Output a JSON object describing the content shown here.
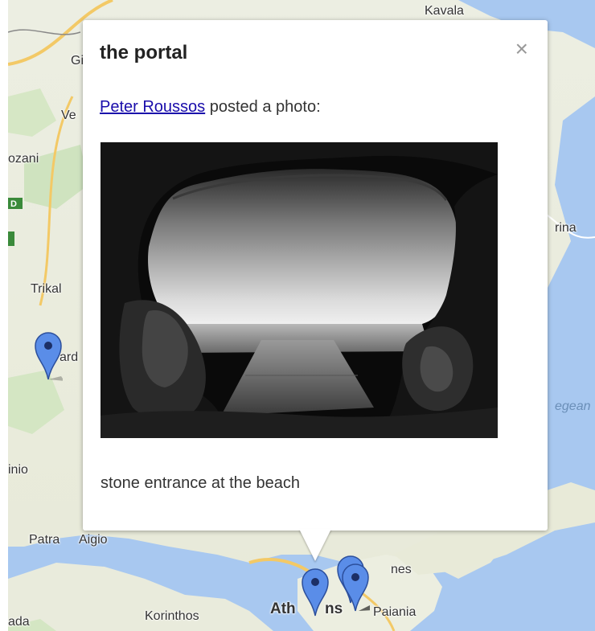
{
  "map": {
    "places": {
      "kavala": "Kavala",
      "gi": "Gi",
      "ve": "Ve",
      "kozani": "ozani",
      "trikala": "Trikal",
      "karditsa": "ard",
      "rina": "rina",
      "aegean": "egean",
      "agrinio": "inio",
      "patra": "Patra",
      "aigio": "Aigio",
      "chalkida": "nes",
      "athina": "Ath",
      "athina_b": "ns",
      "paiania": "Paiania",
      "korinthos": "Korinthos",
      "ada": "ada"
    },
    "highway_badge": "D"
  },
  "popup": {
    "title": "the portal",
    "close_label": "×",
    "author": "Peter Roussos",
    "posted_text": " posted a photo:",
    "caption": "stone entrance at the beach"
  },
  "colors": {
    "marker_blue": "#5a8de8",
    "link": "#1a0dab",
    "water": "#a8c8f0",
    "land": "#eef0e4"
  },
  "icons": [
    "map-pin-icon",
    "close-icon"
  ]
}
